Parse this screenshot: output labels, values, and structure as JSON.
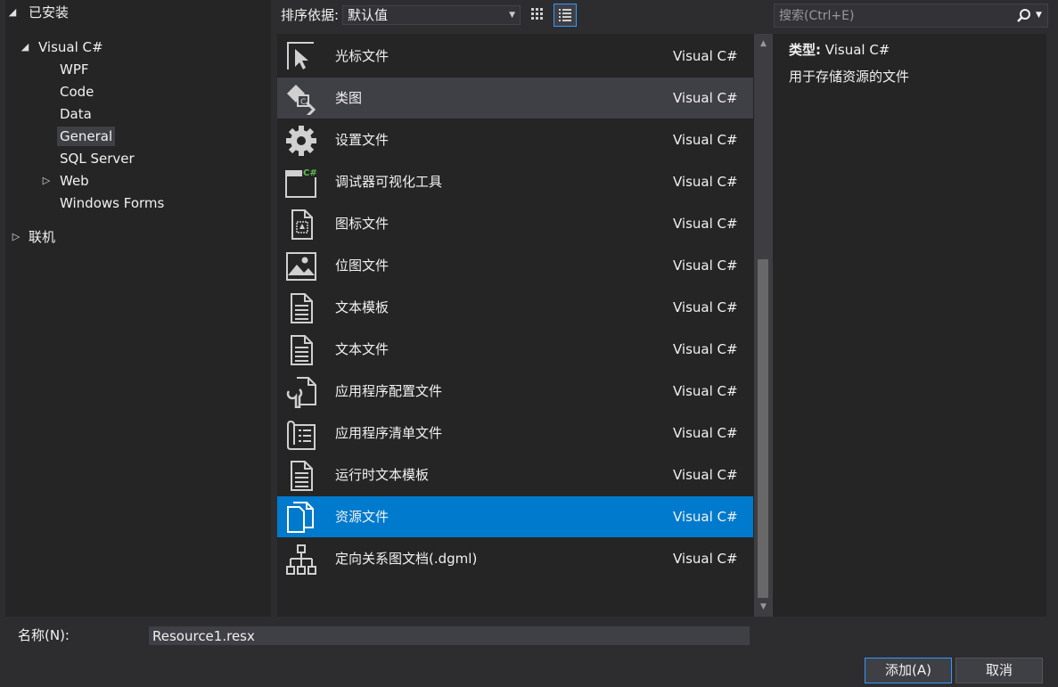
{
  "tree": {
    "installed": {
      "label": "已安装",
      "arrow": "◢"
    },
    "visual_csharp": {
      "label": "Visual C#",
      "arrow": "◢"
    },
    "children": [
      "WPF",
      "Code",
      "Data",
      "General",
      "SQL Server",
      "Web",
      "Windows Forms"
    ],
    "web_arrow": "▷",
    "selected": "General",
    "online": {
      "label": "联机",
      "arrow": "▷"
    }
  },
  "toolbar": {
    "sort_label": "排序依据:",
    "sort_value": "默认值",
    "sort_arrow": "▼"
  },
  "search": {
    "placeholder": "搜索(Ctrl+E)",
    "dropdown": "▼"
  },
  "templates": [
    {
      "name": "光标文件",
      "lang": "Visual C#",
      "icon": "cursor-file-icon"
    },
    {
      "name": "类图",
      "lang": "Visual C#",
      "icon": "class-diagram-icon"
    },
    {
      "name": "设置文件",
      "lang": "Visual C#",
      "icon": "settings-gear-icon"
    },
    {
      "name": "调试器可视化工具",
      "lang": "Visual C#",
      "icon": "debugger-visualizer-icon"
    },
    {
      "name": "图标文件",
      "lang": "Visual C#",
      "icon": "icon-file-icon"
    },
    {
      "name": "位图文件",
      "lang": "Visual C#",
      "icon": "bitmap-file-icon"
    },
    {
      "name": "文本模板",
      "lang": "Visual C#",
      "icon": "text-template-icon"
    },
    {
      "name": "文本文件",
      "lang": "Visual C#",
      "icon": "text-file-icon"
    },
    {
      "name": "应用程序配置文件",
      "lang": "Visual C#",
      "icon": "app-config-icon"
    },
    {
      "name": "应用程序清单文件",
      "lang": "Visual C#",
      "icon": "app-manifest-icon"
    },
    {
      "name": "运行时文本模板",
      "lang": "Visual C#",
      "icon": "runtime-text-template-icon"
    },
    {
      "name": "资源文件",
      "lang": "Visual C#",
      "icon": "resource-file-icon"
    },
    {
      "name": "定向关系图文档(.dgml)",
      "lang": "Visual C#",
      "icon": "dgml-document-icon"
    }
  ],
  "hover_index": 1,
  "selected_index": 11,
  "scroll": {
    "up": "▲",
    "down": "▼"
  },
  "info": {
    "type_label": "类型:",
    "type_value": "Visual C#",
    "description": "用于存储资源的文件"
  },
  "name_field": {
    "label": "名称(N):",
    "value": "Resource1.resx"
  },
  "buttons": {
    "add": "添加(A)",
    "cancel": "取消"
  },
  "colors": {
    "selection": "#007acc",
    "hover": "#3f3f46",
    "panel": "#252526",
    "background": "#2d2d30",
    "text": "#f1f1f1"
  }
}
